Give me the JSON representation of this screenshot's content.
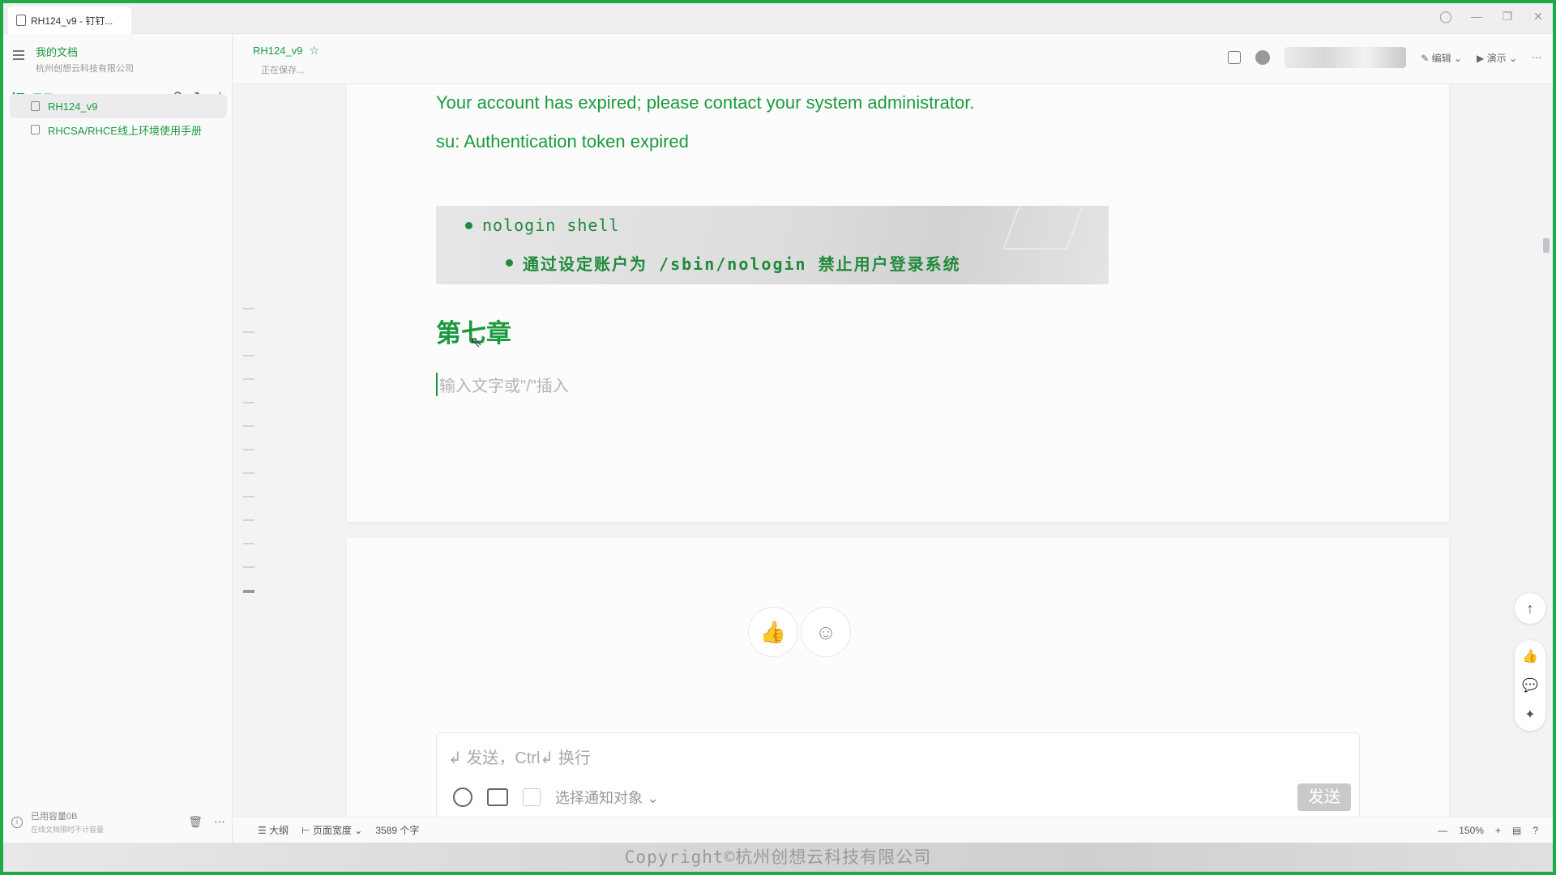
{
  "tab": {
    "title": "RH124_v9 - 钉钉..."
  },
  "window_controls": [
    "◯",
    "—",
    "❐",
    "✕"
  ],
  "sidebar": {
    "title": "我的文档",
    "subtitle": "杭州创想云科技有限公司",
    "toc_label": "目录",
    "items": [
      {
        "label": "RH124_v9",
        "active": true
      },
      {
        "label": "RHCSA/RHCE线上环境使用手册",
        "active": false
      }
    ],
    "footer": {
      "storage_label": "已用容量0B",
      "storage_sub": "在线文档限时不计容量"
    }
  },
  "doc_header": {
    "name": "RH124_v9",
    "status": "正在保存...",
    "tools": {
      "edit_label": "编辑",
      "present_label": "演示"
    }
  },
  "content": {
    "line1": "Your account has expired; please contact your system administrator.",
    "line2": "su: Authentication token expired",
    "bullet1": "nologin shell",
    "bullet2": "通过设定账户为 /sbin/nologin 禁止用户登录系统",
    "chapter": "第七章",
    "placeholder": "输入文字或\"/\"插入"
  },
  "comment": {
    "placeholder": "↲ 发送，Ctrl↲ 换行",
    "notify_label": "选择通知对象",
    "send_label": "发送"
  },
  "statusbar": {
    "outline_label": "大纲",
    "page_width_label": "页面宽度",
    "word_count": "3589 个字",
    "zoom": "150%"
  },
  "watermark": "Copyright©杭州创想云科技有限公司",
  "colors": {
    "accent": "#1a9a3e",
    "frame": "#1faa4a"
  }
}
